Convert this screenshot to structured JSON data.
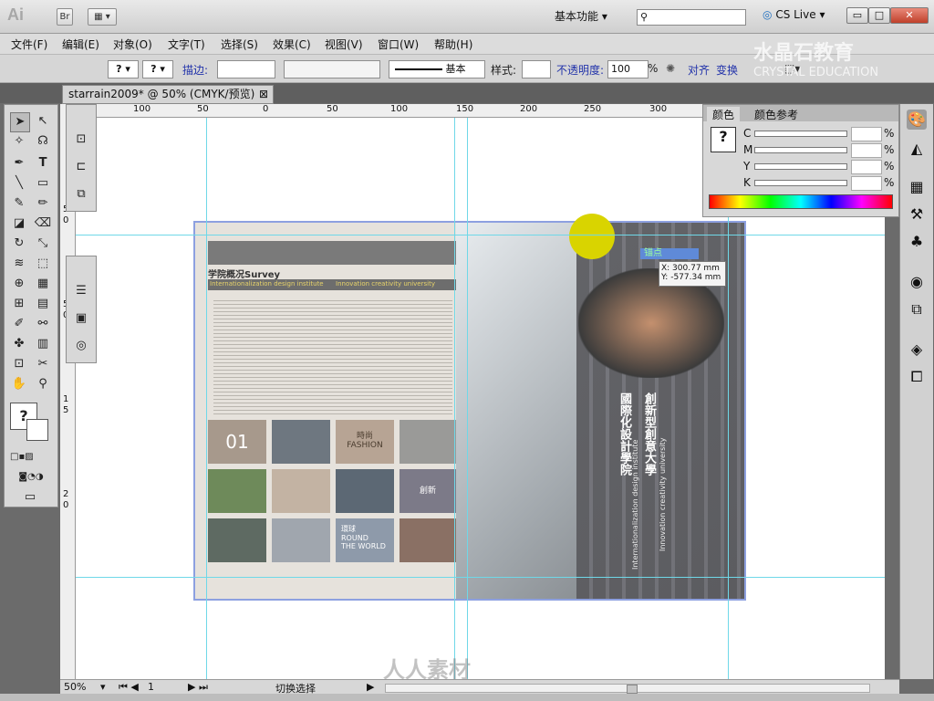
{
  "app": {
    "logo": "Ai",
    "bridge": "Br",
    "workspace": "基本功能",
    "cs_live": "CS Live"
  },
  "window_buttons": {
    "minimize": "▭",
    "maximize": "□",
    "close": "✕"
  },
  "menu": [
    "文件(F)",
    "编辑(E)",
    "对象(O)",
    "文字(T)",
    "选择(S)",
    "效果(C)",
    "视图(V)",
    "窗口(W)",
    "帮助(H)"
  ],
  "controlbar": {
    "q1": "?",
    "q2": "?",
    "stroke_label": "描边:",
    "basic": "基本",
    "style_label": "样式:",
    "opacity_label": "不透明度:",
    "opacity_value": "100",
    "percent": "%",
    "align": "对齐",
    "transform": "变换"
  },
  "watermark": {
    "cn": "水晶石教育",
    "en": "CRYSTAL EDUCATION"
  },
  "document_tab": {
    "title": "starrain2009* @ 50% (CMYK/预览)",
    "close": "⊠"
  },
  "ruler": {
    "top_ticks": [
      "100",
      "50",
      "0",
      "50",
      "100",
      "150",
      "200",
      "250",
      "300"
    ],
    "side_ticks": [
      "5",
      "0",
      "5",
      "0",
      "1",
      "5",
      "2",
      "0",
      "2",
      "5",
      "3",
      "0",
      "3",
      "5"
    ]
  },
  "color_panel": {
    "tab1": "颜色",
    "tab2": "颜色参考",
    "channels": [
      "C",
      "M",
      "Y",
      "K"
    ],
    "percent": "%",
    "question": "?"
  },
  "brochure": {
    "heading": "学院概况Survey",
    "sub_en": "Internationalization design institute",
    "sub_en2": "Innovation creativity university",
    "num": "01",
    "fashion_cn": "時尚",
    "fashion_en": "FASHION",
    "creative_cn": "創新",
    "round_cn": "環球",
    "round_en1": "ROUND",
    "round_en2": "THE WORLD",
    "vertical_cn1": "國際化設計學院",
    "vertical_cn2": "創新型創意大學",
    "vertical_en1": "Internationalization design institute",
    "vertical_en2": "Innovation creativity university"
  },
  "anchor_tooltip": {
    "label": "锚点",
    "x": "X: 300.77 mm",
    "y": "Y: -577.34 mm"
  },
  "status": {
    "zoom": "50%",
    "page": "1",
    "mode": "切换选择"
  },
  "watermark_bottom": "人人素材"
}
